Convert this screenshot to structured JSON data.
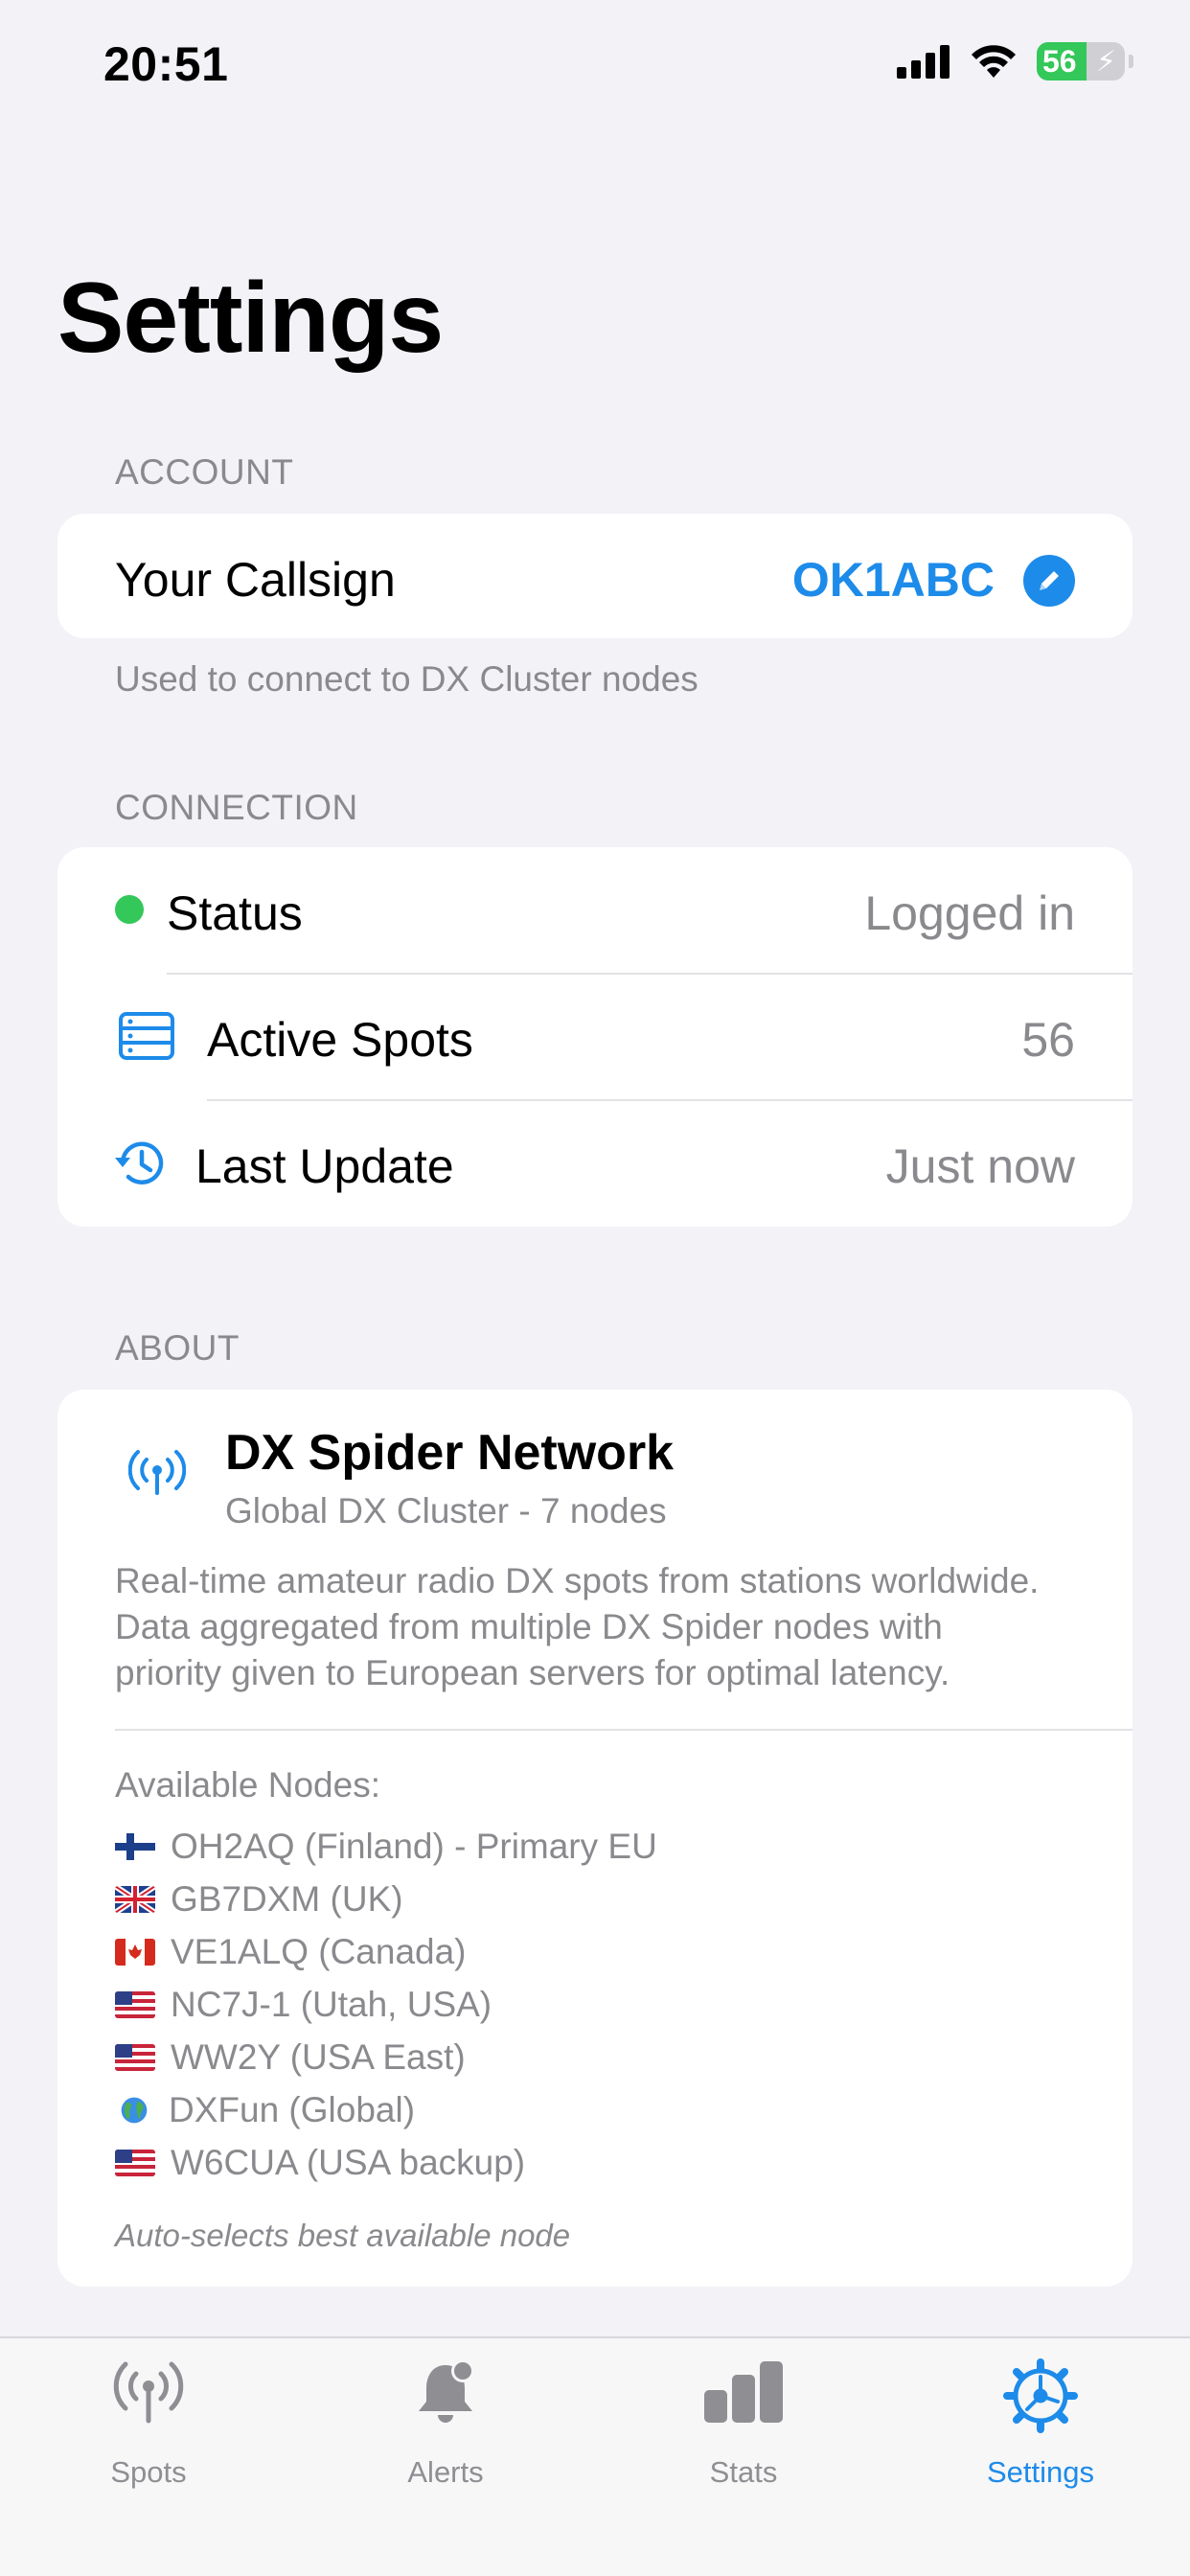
{
  "status_bar": {
    "time": "20:51",
    "battery_level": "56",
    "battery_fraction": 0.56,
    "icons": [
      "cellular-signal-icon",
      "wifi-icon",
      "battery-charging-icon"
    ]
  },
  "page_title": "Settings",
  "account": {
    "header": "ACCOUNT",
    "callsign_label": "Your Callsign",
    "callsign_value": "OK1ABC",
    "footer": "Used to connect to DX Cluster nodes"
  },
  "connection": {
    "header": "CONNECTION",
    "rows": [
      {
        "label": "Status",
        "value": "Logged in",
        "icon": "status-dot-green"
      },
      {
        "label": "Active Spots",
        "value": "56",
        "icon": "server-stack-icon"
      },
      {
        "label": "Last Update",
        "value": "Just now",
        "icon": "history-clock-icon"
      }
    ]
  },
  "about": {
    "header": "ABOUT",
    "title": "DX Spider Network",
    "subtitle": "Global DX Cluster - 7 nodes",
    "description_lines": [
      "Real-time amateur radio DX spots from stations worldwide.",
      "Data aggregated from multiple DX Spider nodes with",
      "priority given to European servers for optimal latency."
    ],
    "nodes_heading": "Available Nodes:",
    "nodes": [
      {
        "flag": "finland-flag-icon",
        "text": "OH2AQ (Finland) - Primary EU"
      },
      {
        "flag": "uk-flag-icon",
        "text": "GB7DXM (UK)"
      },
      {
        "flag": "canada-flag-icon",
        "text": "VE1ALQ (Canada)"
      },
      {
        "flag": "usa-flag-icon",
        "text": "NC7J-1 (Utah, USA)"
      },
      {
        "flag": "usa-flag-icon",
        "text": "WW2Y (USA East)"
      },
      {
        "flag": "globe-icon",
        "text": "DXFun (Global)"
      },
      {
        "flag": "usa-flag-icon",
        "text": "W6CUA (USA backup)"
      }
    ],
    "footnote": "Auto-selects best available node"
  },
  "tab_bar": {
    "tabs": [
      {
        "label": "Spots",
        "icon": "antenna-icon",
        "active": false
      },
      {
        "label": "Alerts",
        "icon": "bell-badge-icon",
        "active": false
      },
      {
        "label": "Stats",
        "icon": "bar-chart-icon",
        "active": false
      },
      {
        "label": "Settings",
        "icon": "gear-icon",
        "active": true
      }
    ]
  },
  "colors": {
    "accent": "#1d8be9",
    "status_green": "#34c759",
    "secondary_text": "#8a8a8e",
    "background": "#f2f2f7"
  }
}
